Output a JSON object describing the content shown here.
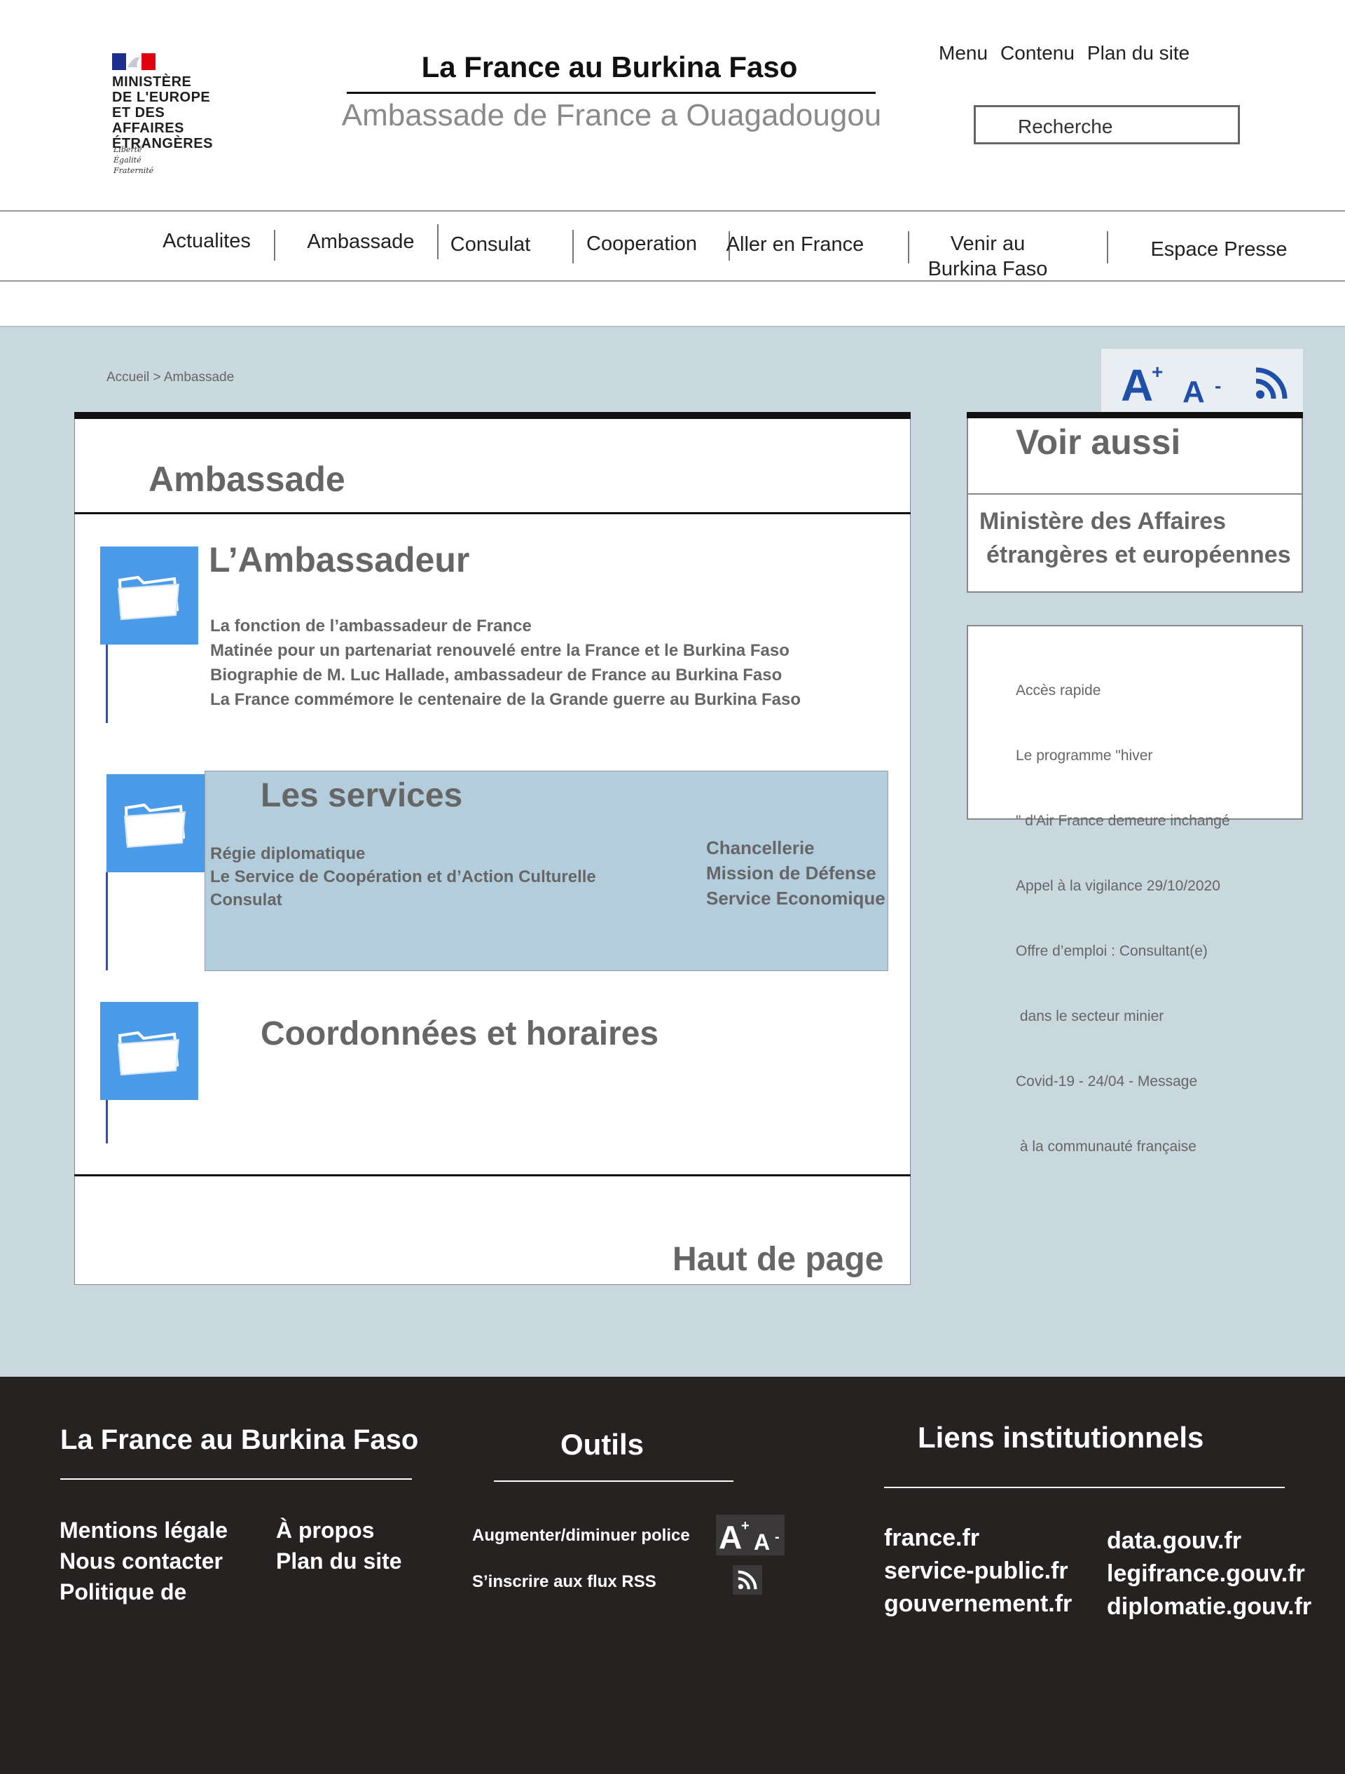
{
  "header": {
    "logo": {
      "lines": [
        "MINISTÈRE",
        "DE L'EUROPE",
        "ET DES AFFAIRES",
        "ÉTRANGÈRES"
      ],
      "motto": [
        "Liberté",
        "Égalité",
        "Fraternité"
      ]
    },
    "site_title": "La France au Burkina Faso",
    "site_subtitle": "Ambassade de France a Ouagadougou",
    "top_links": [
      "Menu",
      "Contenu",
      "Plan du site"
    ],
    "search_placeholder": "Recherche"
  },
  "nav": {
    "items": [
      "Actualites",
      "Ambassade",
      "Consulat",
      "Cooperation",
      "Aller en France",
      "Venir au Burkina Faso",
      "Espace Presse"
    ]
  },
  "breadcrumb": "Accueil > Ambassade",
  "main": {
    "heading": "Ambassade",
    "sections": [
      {
        "title": "L’Ambassadeur",
        "links": [
          "La fonction de l’ambassadeur de France",
          "Matinée pour un partenariat renouvelé entre la France et le Burkina Faso",
          "Biographie de M. Luc Hallade, ambassadeur de France au Burkina Faso",
          "La France commémore le centenaire de la Grande guerre au Burkina Faso"
        ]
      },
      {
        "title": "Les services",
        "links_left": [
          "Régie diplomatique",
          "Le Service de Coopération et d’Action Culturelle",
          "Consulat"
        ],
        "links_right": [
          "Chancellerie",
          "Mission de Défense",
          "Service Economique"
        ]
      },
      {
        "title": "Coordonnées et horaires"
      }
    ],
    "back_to_top": "Haut de page"
  },
  "sidebar": {
    "see_also_title": "Voir aussi",
    "see_also_link": [
      "Ministère des Affaires",
      "étrangères et européennes"
    ],
    "quick_access": [
      "Accès rapide",
      "Le programme \"hiver",
      "\" d'Air France demeure inchangé",
      "Appel à la vigilance 29/10/2020",
      "Offre d’emploi : Consultant(e)",
      " dans le secteur minier",
      "Covid-19 - 24/04 - Message",
      " à la communauté française"
    ]
  },
  "footer": {
    "col1": {
      "title": "La France au Burkina Faso",
      "links_a": [
        "Mentions légale",
        "Nous contacter",
        "Politique de"
      ],
      "links_b": [
        "À propos",
        "Plan du site"
      ]
    },
    "col2": {
      "title": "Outils",
      "font_tool": "Augmenter/diminuer police",
      "rss_tool": "S’inscrire aux flux RSS"
    },
    "col3": {
      "title": "Liens institutionnels",
      "links_a": [
        "france.fr",
        "service-public.fr",
        "gouvernement.fr"
      ],
      "links_b": [
        "data.gouv.fr",
        "legifrance.gouv.fr",
        "diplomatie.gouv.fr"
      ]
    }
  },
  "colors": {
    "main_bg": "#c8d8de",
    "folder_blue": "#4a9ce8",
    "services_bg": "#b3cddd",
    "footer_bg": "#262222",
    "icon_blue": "#1f4fa8"
  }
}
